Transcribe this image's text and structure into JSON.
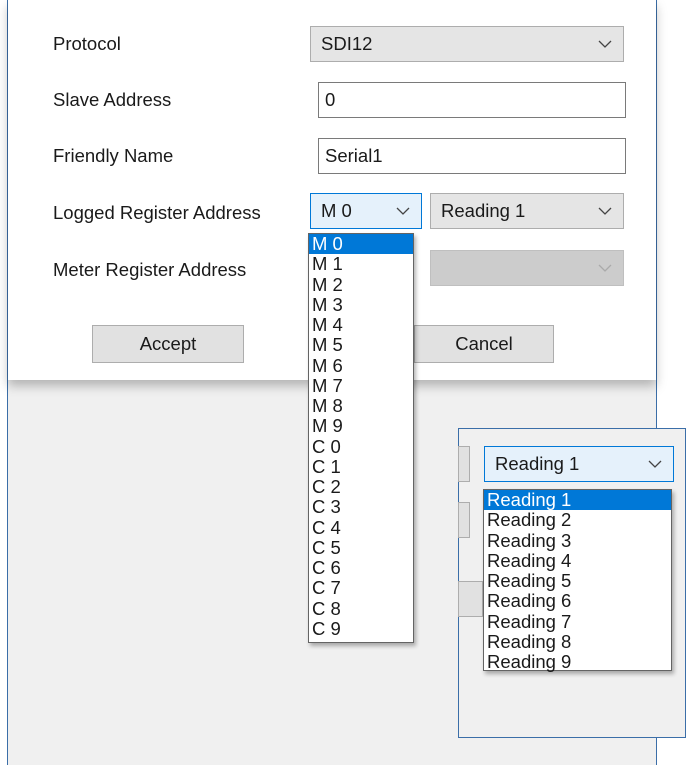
{
  "form": {
    "protocol": {
      "label": "Protocol",
      "value": "SDI12"
    },
    "slave_address": {
      "label": "Slave Address",
      "value": "0"
    },
    "friendly_name": {
      "label": "Friendly Name",
      "value": "Serial1"
    },
    "logged_register": {
      "label": "Logged Register Address",
      "register_value": "M 0",
      "reading_value": "Reading 1"
    },
    "meter_register": {
      "label": "Meter Register Address"
    }
  },
  "buttons": {
    "accept": "Accept",
    "cancel": "Cancel"
  },
  "register_options": [
    "M 0",
    "M 1",
    "M 2",
    "M 3",
    "M 4",
    "M 5",
    "M 6",
    "M 7",
    "M 8",
    "M 9",
    "C 0",
    "C 1",
    "C 2",
    "C 3",
    "C 4",
    "C 5",
    "C 6",
    "C 7",
    "C 8",
    "C 9"
  ],
  "inset": {
    "combo_value": "Reading 1",
    "reading_options": [
      "Reading 1",
      "Reading 2",
      "Reading 3",
      "Reading 4",
      "Reading 5",
      "Reading 6",
      "Reading 7",
      "Reading 8",
      "Reading 9"
    ]
  },
  "colors": {
    "accent": "#0078d7",
    "frame": "#3b6ea8"
  }
}
